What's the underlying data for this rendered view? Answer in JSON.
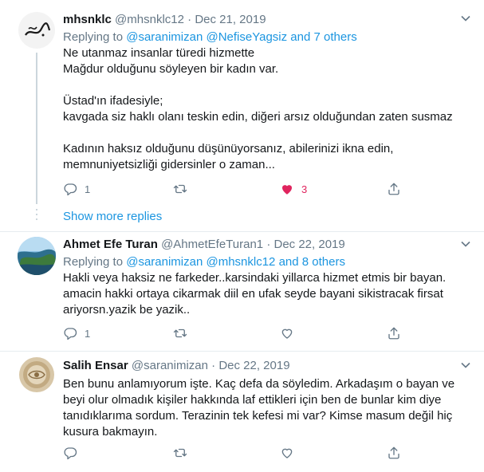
{
  "tweets": [
    {
      "name": "mhsnklc",
      "handle": "@mhsnklc12",
      "sep": "·",
      "date": "Dec 21, 2019",
      "replying_prefix": "Replying to ",
      "replying_links": "@saranimizan @NefiseYagsiz and 7 others",
      "lines": [
        "Ne utanmaz insanlar türedi hizmette",
        "Mağdur olduğunu söyleyen bir kadın var.",
        "",
        "Üstad'ın ifadesiyle;",
        "kavgada siz haklı olanı teskin edin, diğeri arsız olduğundan zaten susmaz",
        "",
        "Kadının haksız olduğunu düşünüyorsanız, abilerinizi ikna edin,",
        "memnuniyetsizliği gidersinler o zaman..."
      ],
      "reply_count": "1",
      "retweet_count": "",
      "like_count": "3"
    },
    {
      "name": "Ahmet Efe Turan",
      "handle": "@AhmetEfeTuran1",
      "sep": "·",
      "date": "Dec 22, 2019",
      "replying_prefix": "Replying to ",
      "replying_links": "@saranimizan @mhsnklc12 and 8 others",
      "lines": [
        "Hakli veya haksiz ne farkeder..karsindaki yillarca hizmet etmis bir bayan.",
        "amacin hakki ortaya cikarmak diil en ufak seyde bayani sikistracak firsat",
        "ariyorsn.yazik be yazik.."
      ],
      "reply_count": "1",
      "retweet_count": "",
      "like_count": ""
    },
    {
      "name": "Salih Ensar",
      "handle": "@saranimizan",
      "sep": "·",
      "date": "Dec 22, 2019",
      "lines": [
        "Ben bunu anlamıyorum işte. Kaç defa da söyledim. Arkadaşım o bayan ve",
        "beyi olur olmadık kişiler hakkında laf ettikleri için ben de bunlar kim diye",
        "tanıdıklarıma sordum. Terazinin tek kefesi mi var? Kimse masum değil hiç",
        "kusura bakmayın."
      ],
      "reply_count": "",
      "retweet_count": "",
      "like_count": ""
    }
  ],
  "show_more_replies": "Show more replies",
  "colors": {
    "accent": "#1b95e0",
    "like": "#e0245e",
    "muted": "#657786",
    "border": "#e6ecf0"
  },
  "icons": [
    "chevron-down-icon",
    "reply-icon",
    "retweet-icon",
    "heart-icon",
    "share-icon"
  ]
}
